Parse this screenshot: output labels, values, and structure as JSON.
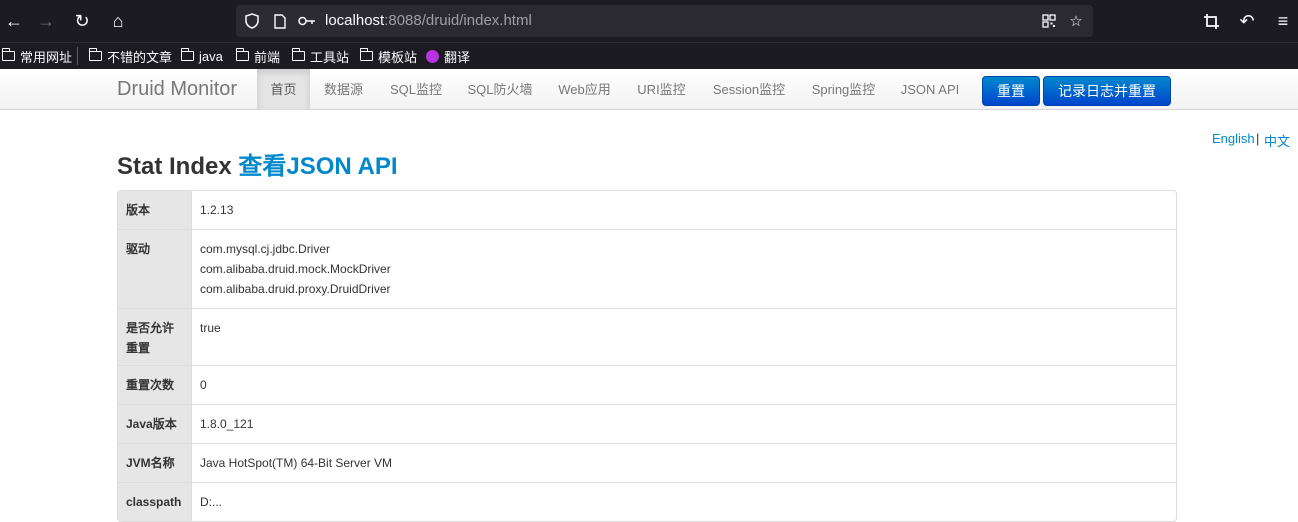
{
  "browser": {
    "url_host": "localhost",
    "url_rest": ":8088/druid/index.html"
  },
  "bookmarks": [
    {
      "label": "常用网址",
      "icon": "folder-icon"
    },
    {
      "label": "不错的文章",
      "icon": "folder-icon"
    },
    {
      "label": "java",
      "icon": "folder-icon"
    },
    {
      "label": "前端",
      "icon": "folder-icon"
    },
    {
      "label": "工具站",
      "icon": "folder-icon"
    },
    {
      "label": "模板站",
      "icon": "folder-icon"
    },
    {
      "label": "翻译",
      "icon": "translate-icon"
    }
  ],
  "navbar": {
    "brand": "Druid Monitor",
    "items": [
      "首页",
      "数据源",
      "SQL监控",
      "SQL防火墙",
      "Web应用",
      "URI监控",
      "Session监控",
      "Spring监控",
      "JSON API"
    ],
    "active_index": 0,
    "reset_button": "重置",
    "log_reset_button": "记录日志并重置"
  },
  "lang": {
    "english": "English",
    "separator": "|",
    "chinese": "中文"
  },
  "title": {
    "prefix": "Stat Index ",
    "link": "查看JSON API"
  },
  "table": [
    {
      "label": "版本",
      "value": "1.2.13"
    },
    {
      "label": "驱动",
      "value": [
        "com.mysql.cj.jdbc.Driver",
        "com.alibaba.druid.mock.MockDriver",
        "com.alibaba.druid.proxy.DruidDriver"
      ]
    },
    {
      "label": "是否允许重置",
      "value": "true"
    },
    {
      "label": "重置次数",
      "value": "0"
    },
    {
      "label": "Java版本",
      "value": "1.8.0_121"
    },
    {
      "label": "JVM名称",
      "value": "Java HotSpot(TM) 64-Bit Server VM"
    },
    {
      "label": "classpath",
      "value": "D:..."
    }
  ],
  "colors": {
    "accent": "#0088cc",
    "toolbar_bg": "#1c1b22"
  }
}
